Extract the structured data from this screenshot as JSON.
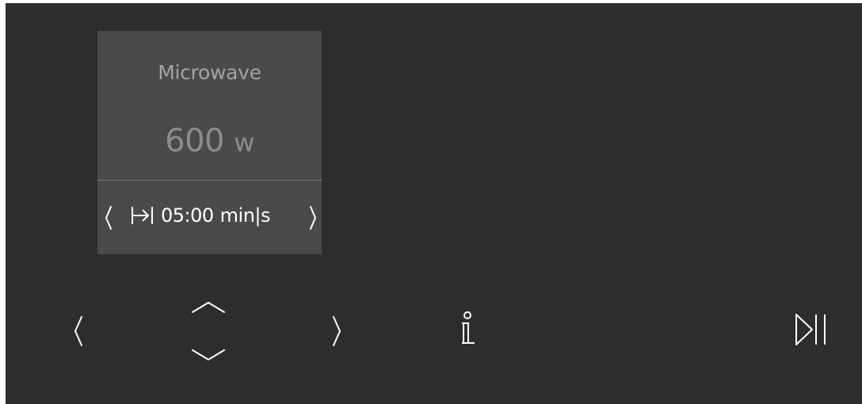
{
  "mode": {
    "title": "Microwave",
    "power_value": "600",
    "power_unit": "w"
  },
  "duration": {
    "value": "05:00",
    "unit": "min|s",
    "icon": "duration-set-icon"
  },
  "controls": {
    "prev_icon": "chevron-left-icon",
    "up_icon": "chevron-up-icon",
    "down_icon": "chevron-down-icon",
    "next_icon": "chevron-right-icon",
    "info_icon": "info-icon",
    "play_pause_icon": "play-pause-icon"
  },
  "colors": {
    "background": "#2d2d2d",
    "card": "#4a4a4a",
    "foreground": "#ffffff"
  }
}
